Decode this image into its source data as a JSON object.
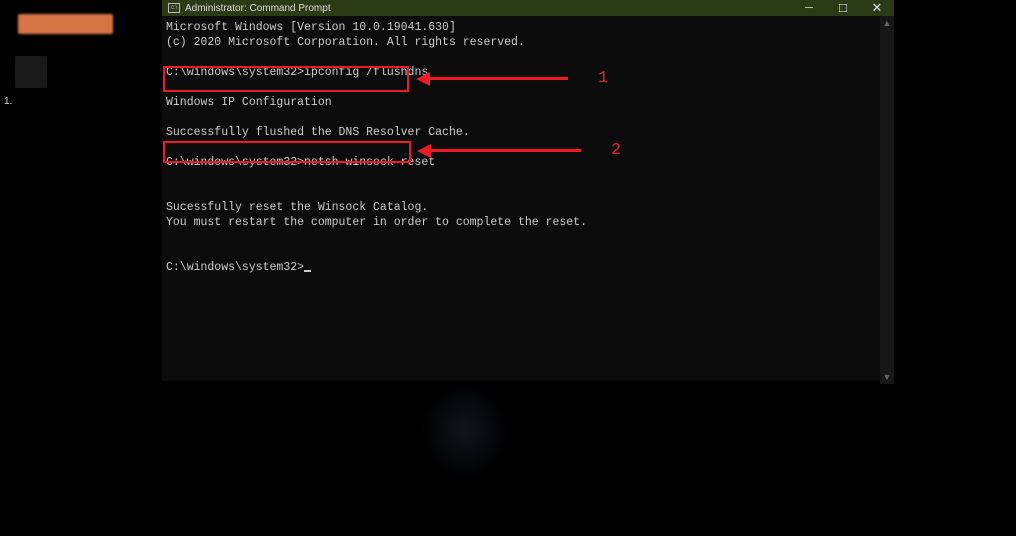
{
  "titlebar": {
    "title": "Administrator: Command Prompt"
  },
  "terminal": {
    "line_version": "Microsoft Windows [Version 10.0.19041.630]",
    "line_copyright": "(c) 2020 Microsoft Corporation. All rights reserved.",
    "prompt1_path": "C:\\windows\\system32>",
    "cmd1": "ipconfig /flushdns",
    "ipconfig_header": "Windows IP Configuration",
    "flush_result": "Successfully flushed the DNS Resolver Cache.",
    "prompt2_path": "C:\\windows\\system32>",
    "cmd2": "netsh winsock reset",
    "reset_result1": "Sucessfully reset the Winsock Catalog.",
    "reset_result2": "You must restart the computer in order to complete the reset.",
    "prompt3_path": "C:\\windows\\system32>"
  },
  "annotations": {
    "label1": "1",
    "label2": "2"
  },
  "desktop": {
    "label1": "1."
  }
}
